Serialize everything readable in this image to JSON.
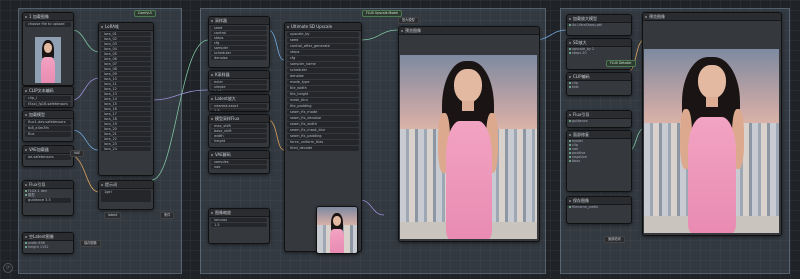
{
  "colors": {
    "canvas": "#1f2226",
    "node": "#35383d",
    "group": "#8ca0b4",
    "link_green": "#7ec4a0",
    "link_purple": "#9a8fd6",
    "link_blue": "#6fa8dc",
    "link_orange": "#d9a25c",
    "dress": "#f0a0c0"
  },
  "groups": [
    {
      "title": ""
    },
    {
      "title": ""
    },
    {
      "title": ""
    }
  ],
  "group1": {
    "load_image": {
      "title": "1 加载图像",
      "rows": [
        "choose file to upload"
      ]
    },
    "clip_text_node": {
      "title": "CLIP文本编码",
      "rows": [
        "clip_l",
        "t5xxl_fp16.safetensors",
        "flux"
      ]
    },
    "model_loader": {
      "title": "加载模型",
      "rows": [
        "flux1-dev.safetensors",
        "fp8_e4m3fn"
      ]
    },
    "vae_loader": {
      "title": "VAE加载器",
      "rows": [
        "ae.safetensors"
      ]
    },
    "guidance": {
      "title": "Flux引导",
      "rows": [
        "guidance 3.5"
      ]
    },
    "lora_list": {
      "title": "LoRA堆",
      "rows": [
        "lora_01",
        "lora_02",
        "lora_03",
        "lora_04",
        "lora_05",
        "lora_06",
        "lora_07",
        "lora_08",
        "lora_09",
        "lora_10",
        "lora_11",
        "lora_12",
        "lora_13",
        "lora_14",
        "lora_15",
        "lora_16",
        "lora_17",
        "lora_18",
        "lora_19",
        "lora_20",
        "lora_21",
        "lora_22",
        "lora_23",
        "lora_24"
      ]
    },
    "latent": {
      "title": "空Latent图像",
      "rows": [
        "width 896",
        "height 1152"
      ]
    },
    "prompt_node": {
      "title": "提示词",
      "rows": [
        "1girl"
      ]
    },
    "save_node": {
      "title": "保存图像",
      "rows": [
        "ComfyUI"
      ]
    },
    "labels": [
      "FLUX.1 dev",
      "模型",
      "VAE",
      "条件",
      "latent"
    ]
  },
  "group2": {
    "left_nodes": [
      {
        "title": "采样器",
        "rows": [
          "seed",
          "control",
          "steps",
          "cfg",
          "sampler",
          "scheduler",
          "denoise"
        ]
      },
      {
        "title": "K采样器",
        "rows": [
          "euler",
          "simple",
          "1.00"
        ]
      },
      {
        "title": "Latent放大",
        "rows": [
          "nearest-exact",
          "1.5"
        ]
      },
      {
        "title": "模型采样Flux",
        "rows": [
          "max_shift",
          "base_shift",
          "width",
          "height"
        ]
      },
      {
        "title": "VAE解码",
        "rows": [
          "samples",
          "vae"
        ]
      },
      {
        "title": "图像缩放",
        "rows": [
          "lanczos",
          "1.5"
        ]
      }
    ],
    "settings_node": {
      "title": "Ultimate SD Upscale",
      "rows": [
        "upscale_by",
        "seed",
        "control_after_generate",
        "steps",
        "cfg",
        "sampler_name",
        "scheduler",
        "denoise",
        "mode_type",
        "tile_width",
        "tile_height",
        "mask_blur",
        "tile_padding",
        "seam_fix_mode",
        "seam_fix_denoise",
        "seam_fix_width",
        "seam_fix_mask_blur",
        "seam_fix_padding",
        "force_uniform_tiles",
        "tiled_decode"
      ]
    },
    "preview_title": "预览图像",
    "badges": [
      "FLUX Upscale Model",
      "放大模型"
    ]
  },
  "group3": {
    "nodes": [
      {
        "title": "加载放大模型",
        "rows": [
          "4x-UltraSharp.pth"
        ]
      },
      {
        "title": "SD放大",
        "rows": [
          "upscale_by 2",
          "steps 20"
        ]
      },
      {
        "title": "CLIP编码",
        "rows": [
          "clip",
          "text"
        ]
      },
      {
        "title": "Flux引导",
        "rows": [
          "guidance"
        ]
      },
      {
        "title": "面部修复",
        "rows": [
          "model",
          "clip",
          "vae",
          "positive",
          "negative",
          "bbox"
        ]
      },
      {
        "title": "保存图像",
        "rows": [
          "filename_prefix"
        ]
      }
    ],
    "preview_title": "预览图像",
    "badges": [
      "FLUX Detailer",
      "面部检测"
    ]
  },
  "footer_icon": "comfy-logo-icon"
}
